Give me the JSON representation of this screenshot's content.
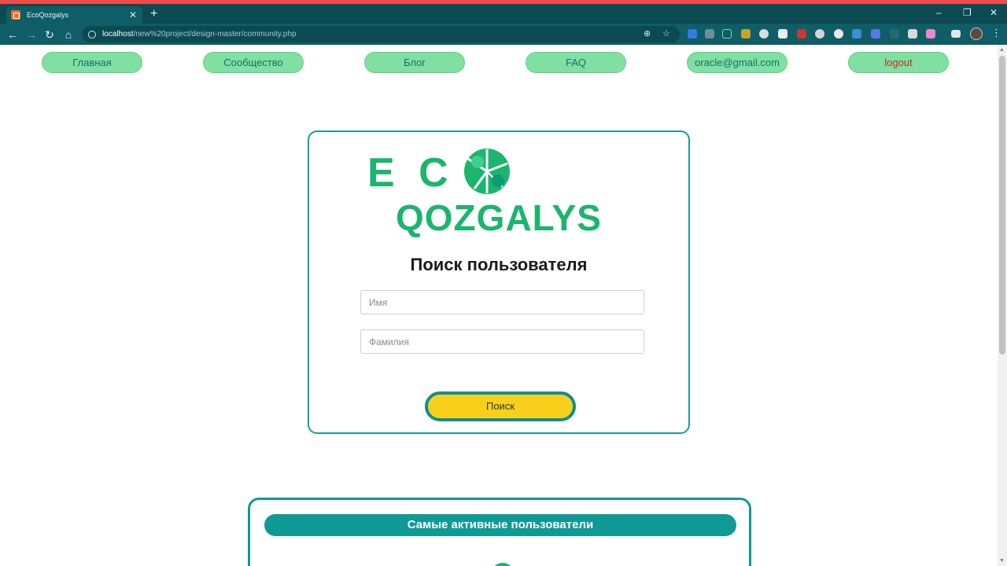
{
  "browser": {
    "tab_title": "EcoQozgalys",
    "close_tab": "✕",
    "new_tab": "+",
    "url_host": "localhost",
    "url_path": "/new%20project/design-master/community.php"
  },
  "nav": {
    "home": "Главная",
    "community": "Сообщество",
    "blog": "Блог",
    "faq": "FAQ",
    "email": "oracle@gmail.com",
    "logout": "logout"
  },
  "logo": {
    "line1": "E C",
    "line2": "QOZGALYS"
  },
  "search": {
    "heading": "Поиск пользователя",
    "first_name_placeholder": "Имя",
    "last_name_placeholder": "Фамилия",
    "button": "Поиск"
  },
  "active_users": {
    "title": "Самые активные пользователи"
  },
  "colors": {
    "accent": "#0f9a96",
    "brand_green": "#1bb56d",
    "nav_pill": "#7fe0a2",
    "button_yellow": "#f8d01c",
    "logout_red": "#c42b1c"
  }
}
